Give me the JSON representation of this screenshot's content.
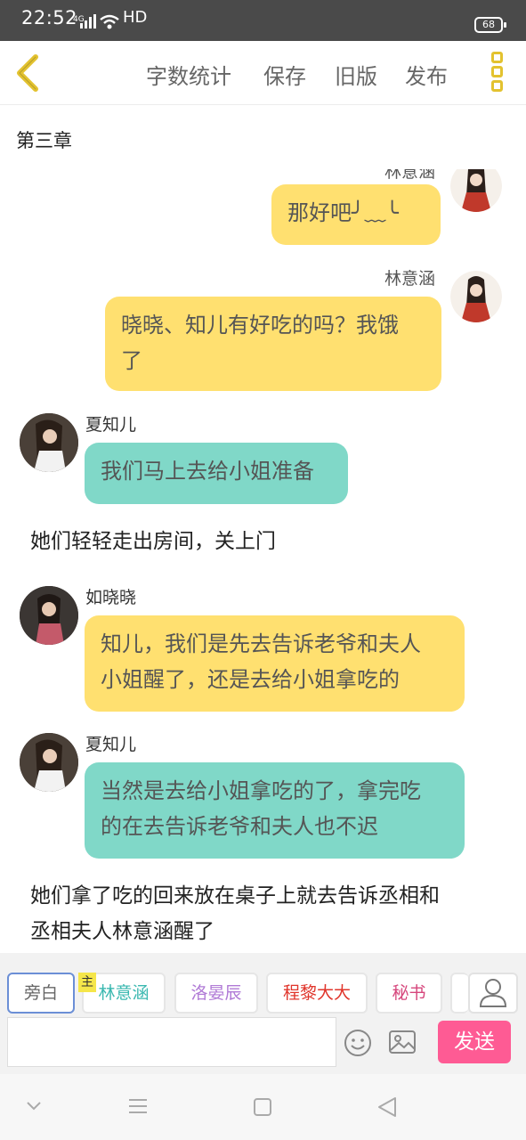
{
  "statusbar": {
    "time": "22:52",
    "signal": "4G",
    "hd": "HD",
    "battery": "68"
  },
  "toolbar": {
    "word_count": "字数统计",
    "save": "保存",
    "old_version": "旧版",
    "publish": "发布"
  },
  "chapter": {
    "title": "第三章"
  },
  "messages": [
    {
      "speaker": "林意涵",
      "text": "那好吧╯﹏╰"
    },
    {
      "speaker": "林意涵",
      "text_line1": "晓晓、知儿有好吃的吗？我饿",
      "text_line2": "了"
    },
    {
      "speaker": "夏知儿",
      "text": "我们马上去给小姐准备"
    },
    {
      "narration": "她们轻轻走出房间，关上门"
    },
    {
      "speaker": "如晓晓",
      "text_line1": "知儿，我们是先去告诉老爷和夫人",
      "text_line2": "小姐醒了，还是去给小姐拿吃的"
    },
    {
      "speaker": "夏知儿",
      "text_line1": "当然是去给小姐拿吃的了，拿完吃",
      "text_line2": "的在去告诉老爷和夫人也不迟"
    },
    {
      "narration_line1": "她们拿了吃的回来放在桌子上就去告诉丞相和",
      "narration_line2": "丞相夫人林意涵醒了"
    }
  ],
  "roles": {
    "main_tag": "主",
    "items": [
      {
        "label": "旁白",
        "color": "#666666"
      },
      {
        "label": "林意涵",
        "color": "#3ab8b0"
      },
      {
        "label": "洛晏辰",
        "color": "#b07ad6"
      },
      {
        "label": "程黎大大",
        "color": "#e0352b"
      },
      {
        "label": "秘书",
        "color": "#d6467c"
      }
    ]
  },
  "input": {
    "placeholder": ""
  },
  "send_label": "发送",
  "icons": [
    "back-icon",
    "more-icon",
    "person-icon",
    "emoji-icon",
    "image-icon",
    "nav-down-icon",
    "nav-menu-icon",
    "nav-home-icon",
    "nav-back-icon"
  ]
}
